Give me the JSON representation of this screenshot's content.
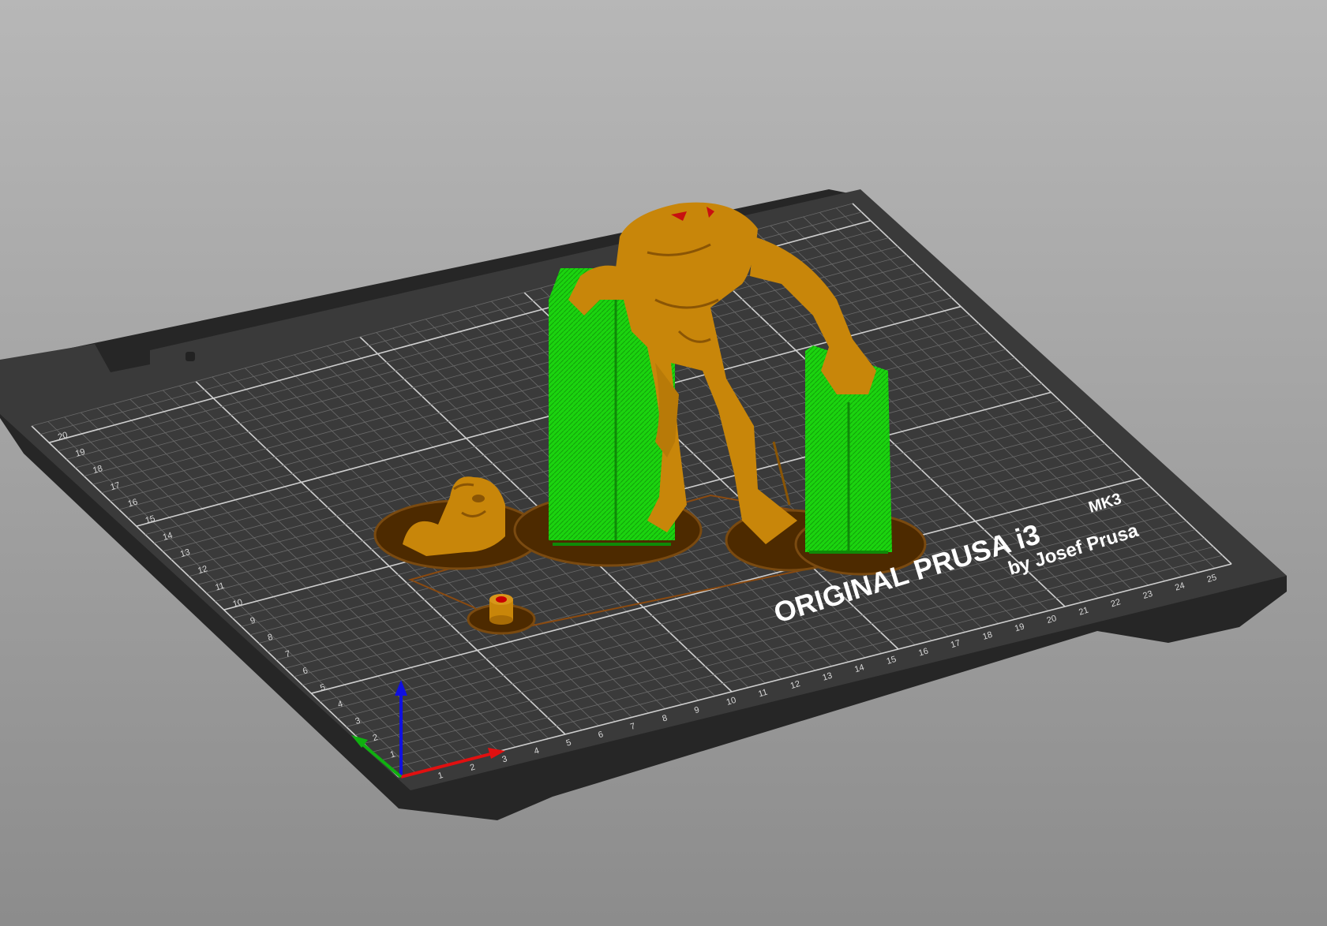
{
  "app": "PrusaSlicer",
  "view": "3d-preview",
  "bed": {
    "brand_line1": "ORIGINAL PRUSA i3",
    "brand_model": "MK3",
    "brand_line2": "by Josef Prusa",
    "x_ticks": [
      "1",
      "2",
      "3",
      "4",
      "5",
      "6",
      "7",
      "8",
      "9",
      "10",
      "11",
      "12",
      "13",
      "14",
      "15",
      "16",
      "17",
      "18",
      "19",
      "20",
      "21",
      "22",
      "23",
      "24",
      "25"
    ],
    "y_ticks": [
      "1",
      "2",
      "3",
      "4",
      "5",
      "6",
      "7",
      "8",
      "9",
      "10",
      "11",
      "12",
      "13",
      "14",
      "15",
      "16",
      "17",
      "18",
      "19",
      "20"
    ]
  },
  "colors": {
    "background_top": "#b7b7b7",
    "background_bottom": "#8c8c8c",
    "bed_surface": "#3a3a3a",
    "bed_edge": "#262626",
    "grid_minor": "#6a6a6a",
    "grid_major": "#cfcfcf",
    "model": "#c8860a",
    "support": "#1bd40f",
    "skirt": "#5c3200",
    "axis_x": "#e01010",
    "axis_y": "#10b010",
    "axis_z": "#1010e0"
  },
  "objects": [
    "monster-figure",
    "head-bust",
    "small-cylinder",
    "support-tower-left",
    "support-tower-right"
  ]
}
